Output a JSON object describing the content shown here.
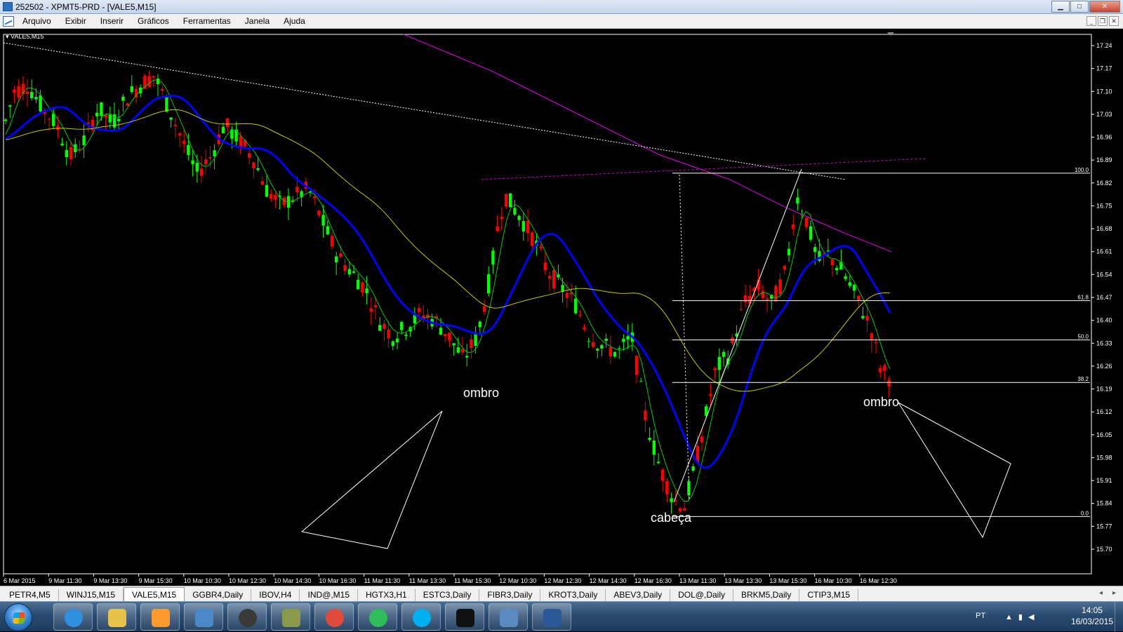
{
  "window": {
    "title": "252502 - XPMT5-PRD - [VALE5,M15]",
    "buttons": {
      "minimize": "▁",
      "maximize": "□",
      "close": "✕"
    }
  },
  "menu": {
    "items": [
      "Arquivo",
      "Exibir",
      "Inserir",
      "Gráficos",
      "Ferramentas",
      "Janela",
      "Ajuda"
    ],
    "mdi_buttons": [
      "_",
      "❐",
      "✕"
    ]
  },
  "chart": {
    "symbol_label": "VALE5,M15",
    "colors": {
      "bull": "#00ff00",
      "bear": "#ff0000",
      "ma_fast": "#00c800",
      "ma_mid": "#0000ff",
      "ma_slow": "#c8c800",
      "ma_long": "#cc00cc",
      "fib": "#ffffff",
      "text": "#ffffff"
    },
    "price_axis": [
      "17.24",
      "17.17",
      "17.10",
      "17.03",
      "16.96",
      "16.89",
      "16.82",
      "16.75",
      "16.68",
      "16.61",
      "16.54",
      "16.47",
      "16.40",
      "16.33",
      "16.26",
      "16.19",
      "16.12",
      "16.05",
      "15.98",
      "15.91",
      "15.84",
      "15.77",
      "15.70"
    ],
    "price_range": [
      15.7,
      17.24
    ],
    "time_axis": [
      "6 Mar 2015",
      "9 Mar 11:30",
      "9 Mar 13:30",
      "9 Mar 15:30",
      "10 Mar 10:30",
      "10 Mar 12:30",
      "10 Mar 14:30",
      "10 Mar 16:30",
      "11 Mar 11:30",
      "11 Mar 13:30",
      "11 Mar 15:30",
      "12 Mar 10:30",
      "12 Mar 12:30",
      "12 Mar 14:30",
      "12 Mar 16:30",
      "13 Mar 11:30",
      "13 Mar 13:30",
      "13 Mar 15:30",
      "16 Mar 10:30",
      "16 Mar 12:30"
    ],
    "fib_levels": [
      {
        "label": "100.0",
        "price": 16.85
      },
      {
        "label": "61.8",
        "price": 16.46
      },
      {
        "label": "50.0",
        "price": 16.34
      },
      {
        "label": "38.2",
        "price": 16.21
      },
      {
        "label": "0.0",
        "price": 15.8
      }
    ],
    "annotations": [
      {
        "text": "ombro"
      },
      {
        "text": "cabeça"
      },
      {
        "text": "ombro"
      }
    ]
  },
  "tabs": {
    "items": [
      "PETR4,M5",
      "WINJ15,M15",
      "VALE5,M15",
      "GGBR4,Daily",
      "IBOV,H4",
      "IND@,M15",
      "HGTX3,H1",
      "ESTC3,Daily",
      "FIBR3,Daily",
      "KROT3,Daily",
      "ABEV3,Daily",
      "DOL@,Daily",
      "BRKM5,Daily",
      "CTIP3,M15"
    ],
    "active": "VALE5,M15",
    "scroll": [
      "◂",
      "▸"
    ]
  },
  "taskbar": {
    "apps": [
      {
        "name": "internet-explorer",
        "color": "#2f8fe0"
      },
      {
        "name": "file-explorer",
        "color": "#e8c14a"
      },
      {
        "name": "media-player",
        "color": "#ff9a2e"
      },
      {
        "name": "network-app",
        "color": "#4a88c8"
      },
      {
        "name": "hp-app",
        "color": "#3a3a3a"
      },
      {
        "name": "archive-app",
        "color": "#8a9a4a"
      },
      {
        "name": "chrome",
        "color": "#e04a3a"
      },
      {
        "name": "spotify",
        "color": "#2ebd59"
      },
      {
        "name": "skype",
        "color": "#00aff0"
      },
      {
        "name": "xp-trading",
        "color": "#111111"
      },
      {
        "name": "calculator-app",
        "color": "#5a8ac0"
      },
      {
        "name": "word",
        "color": "#2b5797"
      }
    ],
    "language": "PT",
    "time": "14:05",
    "date": "16/03/2015"
  }
}
